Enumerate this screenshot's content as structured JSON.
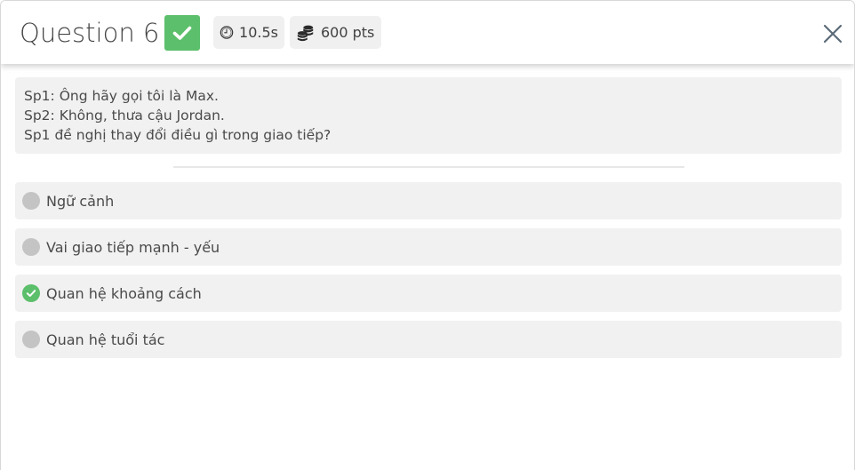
{
  "header": {
    "title": "Question 6",
    "correct_icon": "check-icon",
    "correct_color": "#5cbf6b",
    "time_icon": "clock-icon",
    "time_value": "10.5s",
    "points_icon": "coins-icon",
    "points_value": "600 pts",
    "close_icon": "close-icon"
  },
  "question": {
    "lines": [
      "Sp1: Ông hãy gọi tôi là Max.",
      "Sp2: Không, thưa cậu Jordan.",
      "Sp1 đề nghị thay đổi điều gì trong giao tiếp?"
    ]
  },
  "options": [
    {
      "label": "Ngữ cảnh",
      "correct": false
    },
    {
      "label": "Vai giao tiếp mạnh - yếu",
      "correct": false
    },
    {
      "label": "Quan hệ khoảng cách",
      "correct": true
    },
    {
      "label": "Quan hệ tuổi tác",
      "correct": false
    }
  ]
}
